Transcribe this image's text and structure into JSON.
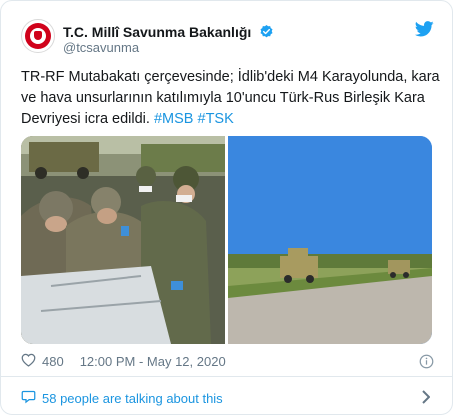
{
  "account": {
    "name": "T.C. Millî Savunma Bakanlığı",
    "handle": "@tcsavunma"
  },
  "tweet": {
    "text": "TR-RF Mutabakatı çerçevesinde; İdlib'deki M4 Karayolunda, kara ve hava unsurlarının katılımıyla 10'uncu Türk-Rus Birleşik Kara Devriyesi icra edildi.",
    "hashtags": [
      "#MSB",
      "#TSK"
    ]
  },
  "stats": {
    "likes": "480",
    "timestamp": "12:00 PM - May 12, 2020"
  },
  "footer": {
    "talking": "58 people are talking about this"
  },
  "icons": {
    "verified": "verified-badge-icon",
    "brand": "twitter-bird-icon",
    "like": "heart-icon",
    "info": "info-icon",
    "comments": "speech-bubble-icon",
    "chevron": "chevron-right-icon"
  },
  "colors": {
    "link": "#1b95e0",
    "text": "#14171a",
    "muted": "#657786",
    "logo_red": "#d0021b"
  }
}
